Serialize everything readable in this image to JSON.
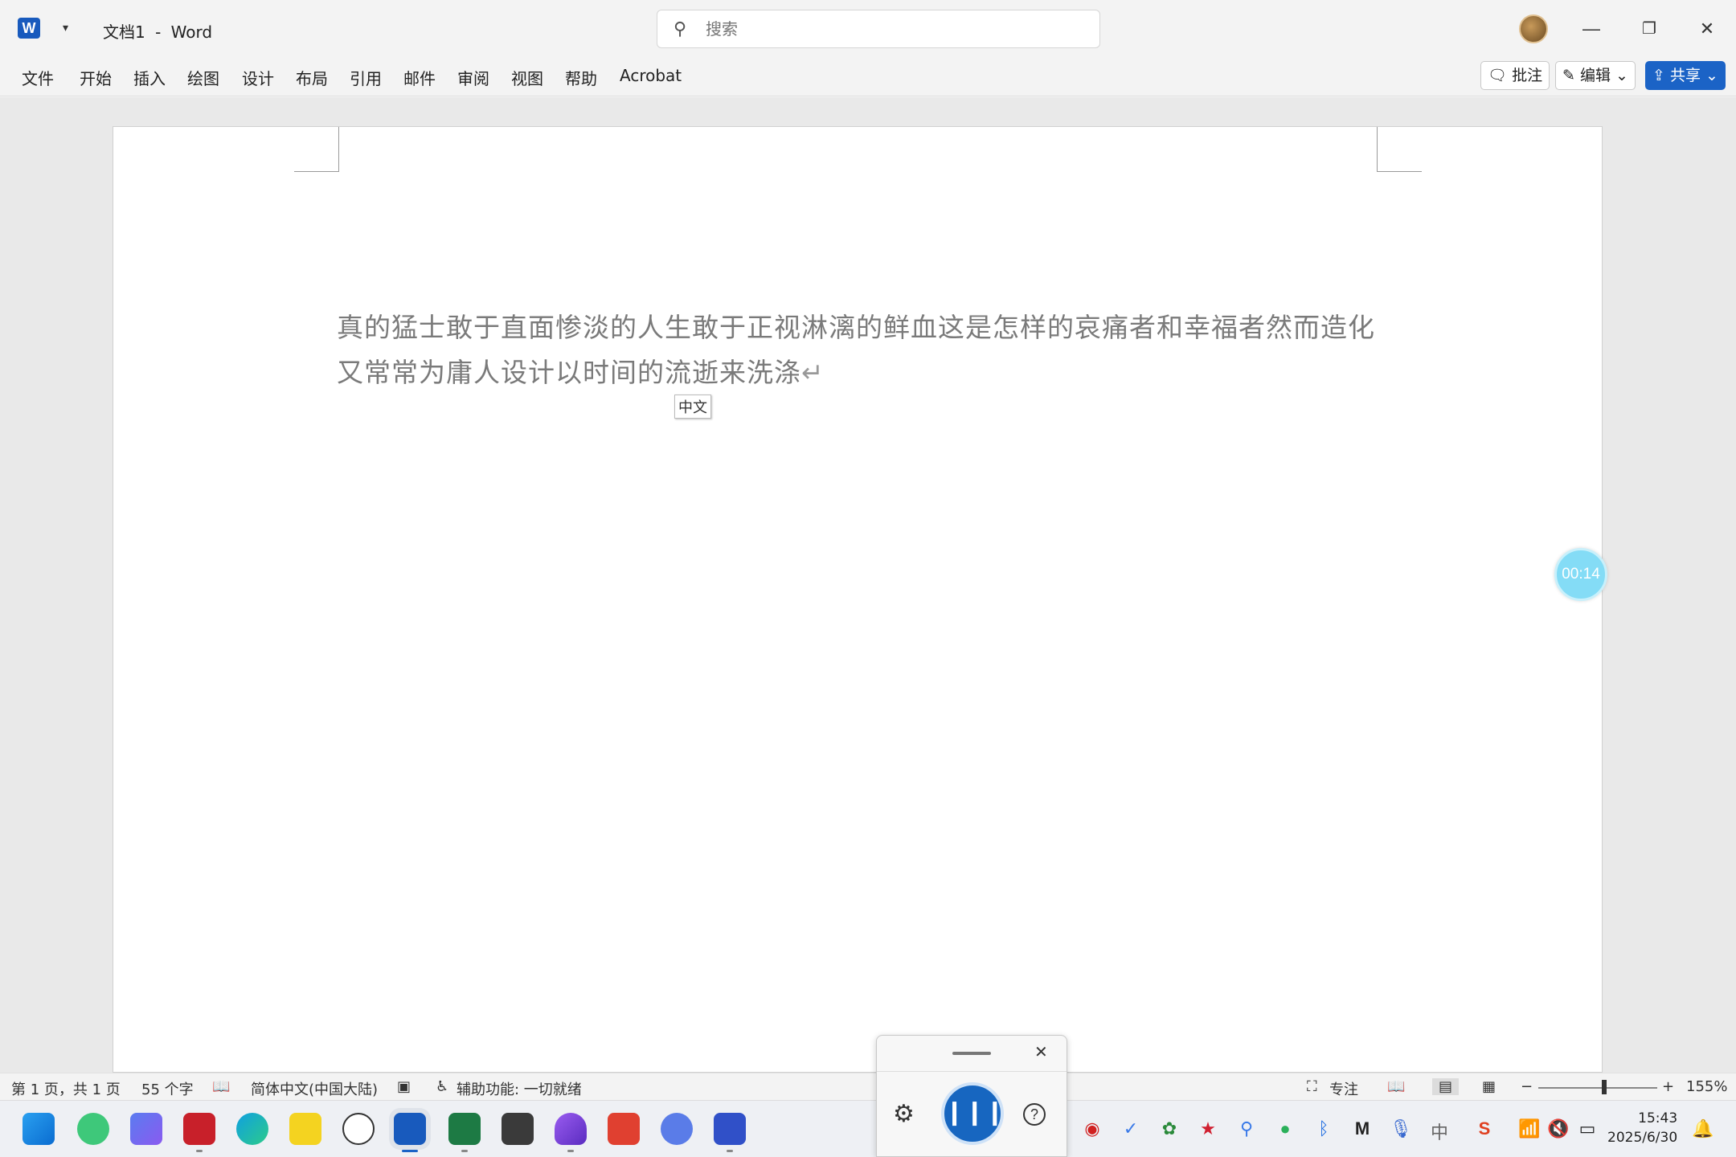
{
  "titlebar": {
    "app_logo": "W",
    "doc_name": "文档1",
    "separator": "-",
    "app_name": "Word",
    "search_placeholder": "搜索"
  },
  "menu": {
    "items": [
      "文件",
      "开始",
      "插入",
      "绘图",
      "设计",
      "布局",
      "引用",
      "邮件",
      "审阅",
      "视图",
      "帮助",
      "Acrobat"
    ],
    "comment_button": "批注",
    "edit_button": "编辑",
    "share_button": "共享"
  },
  "document": {
    "text": "真的猛士敢于直面惨淡的人生敢于正视淋漓的鲜血这是怎样的哀痛者和幸福者然而造化又常常为庸人设计以时间的流逝来洗涤",
    "paragraph_mark": "↵",
    "ime_indicator": "中文"
  },
  "timer": {
    "value": "00:14"
  },
  "status": {
    "page": "第 1 页，共 1 页",
    "words": "55 个字",
    "language": "简体中文(中国大陆)",
    "accessibility": "辅助功能: 一切就绪",
    "focus": "专注",
    "zoom_minus": "−",
    "zoom_plus": "+",
    "zoom": "155%"
  },
  "taskbar": {
    "time": "15:43",
    "date": "2025/6/30"
  },
  "icons": {
    "search": "search-icon",
    "close": "close-icon",
    "minimize": "minimize-icon",
    "restore": "restore-icon",
    "settings": "gear-icon",
    "help": "help-icon",
    "pause": "pause-icon"
  },
  "colors": {
    "accent": "#1b63c6",
    "word_blue": "#185abd",
    "timer": "#84dcf6"
  }
}
